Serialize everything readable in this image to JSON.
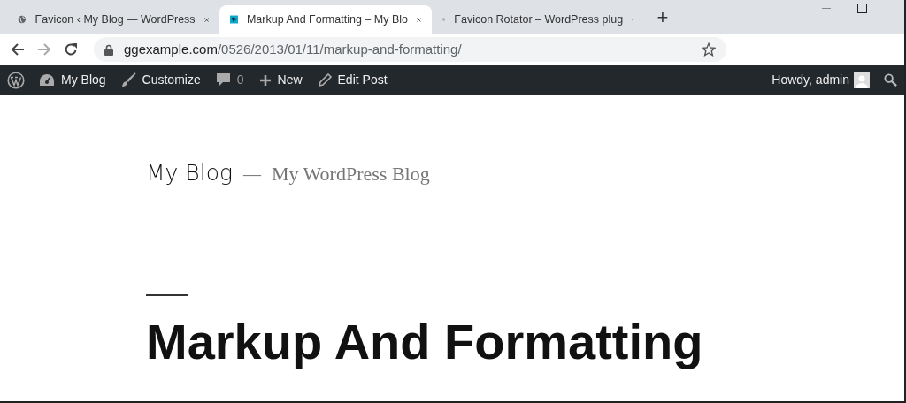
{
  "tabs": [
    {
      "title": "Favicon ‹ My Blog — WordPress",
      "selected": false
    },
    {
      "title": "Markup And Formatting – My Blo",
      "selected": true
    },
    {
      "title": "Favicon Rotator – WordPress plug",
      "selected": false
    }
  ],
  "new_tab": "+",
  "address": {
    "host": "ggexample.com",
    "path": "/0526/2013/01/11/markup-and-formatting/"
  },
  "admin_bar": {
    "items": [
      {
        "label": "My Blog"
      },
      {
        "label": "Customize"
      },
      {
        "label": "0"
      },
      {
        "label": "New"
      },
      {
        "label": "Edit Post"
      }
    ],
    "greeting": "Howdy, admin"
  },
  "site": {
    "title": "My Blog",
    "separator": "—",
    "tagline": "My WordPress Blog"
  },
  "post": {
    "title": "Markup And Formatting"
  }
}
